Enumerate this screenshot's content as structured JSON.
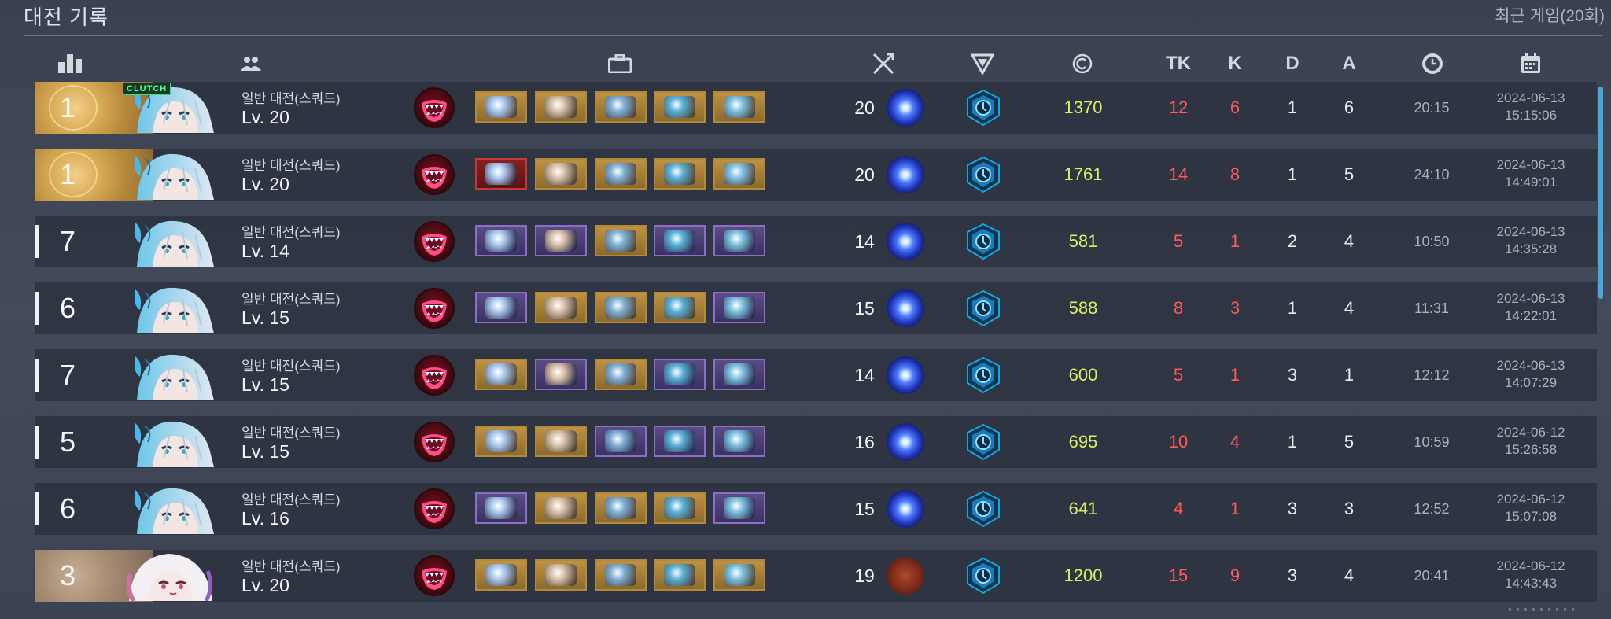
{
  "header": {
    "title": "대전 기록",
    "recent_label": "최근 게임(20회)"
  },
  "columns": [
    {
      "id": "rank",
      "icon": "rank-chart-icon"
    },
    {
      "id": "player",
      "icon": "squad-people-icon"
    },
    {
      "id": "items",
      "icon": "briefcase-icon"
    },
    {
      "id": "level",
      "icon": "crossed-swords-icon"
    },
    {
      "id": "tactical",
      "icon": "triangle-logo-icon"
    },
    {
      "id": "credits",
      "icon": "credit-coin-icon"
    },
    {
      "id": "team_kills",
      "label": "TK"
    },
    {
      "id": "kills",
      "label": "K"
    },
    {
      "id": "deaths",
      "label": "D"
    },
    {
      "id": "assists",
      "label": "A"
    },
    {
      "id": "duration",
      "icon": "clock-icon"
    },
    {
      "id": "date",
      "icon": "calendar-icon"
    }
  ],
  "colors": {
    "coin": "#d9f06a",
    "kill_red": "#ff5a5a",
    "rank_gold": "#d9ab55",
    "rank_bronze": "#a58a72",
    "clutch_green": "#55ff8e"
  },
  "matches": [
    {
      "rank": "1",
      "rank_style": "gold",
      "clutch": "CLUTCH",
      "avatar": "silver-hair-character",
      "mode": "일반 대전(스쿼드)",
      "level": "Lv. 20",
      "items": [
        "gold",
        "gold",
        "gold",
        "gold",
        "gold"
      ],
      "skill_level": "20",
      "skill_orb": "blue",
      "credits": "1370",
      "tk": "12",
      "k": "6",
      "d": "1",
      "a": "6",
      "duration": "20:15",
      "date": "2024-06-13",
      "time": "15:15:06"
    },
    {
      "rank": "1",
      "rank_style": "gold",
      "clutch": "",
      "avatar": "silver-hair-character",
      "mode": "일반 대전(스쿼드)",
      "level": "Lv. 20",
      "items": [
        "red",
        "gold",
        "gold",
        "gold",
        "gold"
      ],
      "skill_level": "20",
      "skill_orb": "blue",
      "credits": "1761",
      "tk": "14",
      "k": "8",
      "d": "1",
      "a": "5",
      "duration": "24:10",
      "date": "2024-06-13",
      "time": "14:49:01"
    },
    {
      "rank": "7",
      "rank_style": "plain",
      "clutch": "",
      "avatar": "silver-hair-character",
      "mode": "일반 대전(스쿼드)",
      "level": "Lv. 14",
      "items": [
        "purple",
        "purple",
        "gold",
        "purple",
        "purple"
      ],
      "skill_level": "14",
      "skill_orb": "blue",
      "credits": "581",
      "tk": "5",
      "k": "1",
      "d": "2",
      "a": "4",
      "duration": "10:50",
      "date": "2024-06-13",
      "time": "14:35:28"
    },
    {
      "rank": "6",
      "rank_style": "plain",
      "clutch": "",
      "avatar": "silver-hair-character",
      "mode": "일반 대전(스쿼드)",
      "level": "Lv. 15",
      "items": [
        "purple",
        "gold",
        "gold",
        "gold",
        "purple"
      ],
      "skill_level": "15",
      "skill_orb": "blue",
      "credits": "588",
      "tk": "8",
      "k": "3",
      "d": "1",
      "a": "4",
      "duration": "11:31",
      "date": "2024-06-13",
      "time": "14:22:01"
    },
    {
      "rank": "7",
      "rank_style": "plain",
      "clutch": "",
      "avatar": "silver-hair-character",
      "mode": "일반 대전(스쿼드)",
      "level": "Lv. 15",
      "items": [
        "gold",
        "purple",
        "gold",
        "purple",
        "purple"
      ],
      "skill_level": "14",
      "skill_orb": "blue",
      "credits": "600",
      "tk": "5",
      "k": "1",
      "d": "3",
      "a": "1",
      "duration": "12:12",
      "date": "2024-06-13",
      "time": "14:07:29"
    },
    {
      "rank": "5",
      "rank_style": "plain",
      "clutch": "",
      "avatar": "silver-hair-character",
      "mode": "일반 대전(스쿼드)",
      "level": "Lv. 15",
      "items": [
        "gold",
        "gold",
        "purple",
        "purple",
        "purple"
      ],
      "skill_level": "16",
      "skill_orb": "blue",
      "credits": "695",
      "tk": "10",
      "k": "4",
      "d": "1",
      "a": "5",
      "duration": "10:59",
      "date": "2024-06-12",
      "time": "15:26:58"
    },
    {
      "rank": "6",
      "rank_style": "plain",
      "clutch": "",
      "avatar": "silver-hair-character",
      "mode": "일반 대전(스쿼드)",
      "level": "Lv. 16",
      "items": [
        "purple",
        "gold",
        "gold",
        "gold",
        "purple"
      ],
      "skill_level": "15",
      "skill_orb": "blue",
      "credits": "641",
      "tk": "4",
      "k": "1",
      "d": "3",
      "a": "3",
      "duration": "12:52",
      "date": "2024-06-12",
      "time": "15:07:08"
    },
    {
      "rank": "3",
      "rank_style": "bronze",
      "clutch": "",
      "avatar": "white-hair-character",
      "mode": "일반 대전(스쿼드)",
      "level": "Lv. 20",
      "items": [
        "gold",
        "gold",
        "gold",
        "gold",
        "gold"
      ],
      "skill_level": "19",
      "skill_orb": "sword",
      "credits": "1200",
      "tk": "15",
      "k": "9",
      "d": "3",
      "a": "4",
      "duration": "20:41",
      "date": "2024-06-12",
      "time": "14:43:43"
    }
  ]
}
